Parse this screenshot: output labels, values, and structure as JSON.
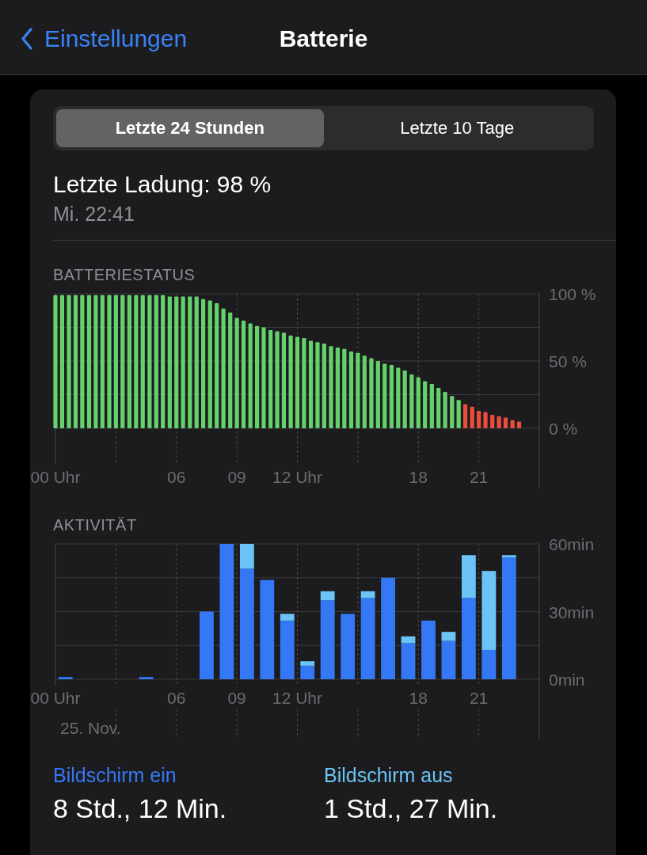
{
  "nav": {
    "back_label": "Einstellungen",
    "title": "Batterie"
  },
  "segments": [
    {
      "label": "Letzte 24 Stunden",
      "selected": true
    },
    {
      "label": "Letzte 10 Tage",
      "selected": false
    }
  ],
  "last_charge": {
    "title": "Letzte Ladung: 98 %",
    "time": "Mi. 22:41"
  },
  "battery": {
    "heading": "BATTERIESTATUS",
    "chart_data": {
      "type": "bar",
      "grid": true,
      "xlim": [
        0,
        24
      ],
      "ylim": [
        0,
        100
      ],
      "xticks": [
        {
          "value": 0,
          "label": "00 Uhr"
        },
        {
          "value": 6,
          "label": "06"
        },
        {
          "value": 9,
          "label": "09"
        },
        {
          "value": 12,
          "label": "12 Uhr"
        },
        {
          "value": 18,
          "label": "18"
        },
        {
          "value": 21,
          "label": "21"
        }
      ],
      "yticks": [
        {
          "value": 100,
          "label": "100 %"
        },
        {
          "value": 50,
          "label": "50 %"
        },
        {
          "value": 0,
          "label": "0 %"
        }
      ],
      "x": [
        0,
        0.33,
        0.67,
        1,
        1.33,
        1.67,
        2,
        2.33,
        2.67,
        3,
        3.33,
        3.67,
        4,
        4.33,
        4.67,
        5,
        5.33,
        5.67,
        6,
        6.33,
        6.67,
        7,
        7.33,
        7.67,
        8,
        8.33,
        8.67,
        9,
        9.33,
        9.67,
        10,
        10.33,
        10.67,
        11,
        11.33,
        11.67,
        12,
        12.33,
        12.67,
        13,
        13.33,
        13.67,
        14,
        14.33,
        14.67,
        15,
        15.33,
        15.67,
        16,
        16.33,
        16.67,
        17,
        17.33,
        17.67,
        18,
        18.33,
        18.67,
        19,
        19.33,
        19.67,
        20,
        20.33,
        20.67,
        21,
        21.33,
        21.67,
        22,
        22.33,
        22.67,
        23
      ],
      "series": [
        {
          "color": "#65d16c",
          "values": [
            99,
            99,
            99,
            99,
            99,
            99,
            99,
            99,
            99,
            99,
            99,
            99,
            99,
            99,
            99,
            99,
            99,
            98,
            98,
            98,
            98,
            98,
            96,
            95,
            93,
            89,
            86,
            82,
            80,
            78,
            76,
            75,
            73,
            72,
            71,
            69,
            68,
            67,
            65,
            64,
            63,
            61,
            60,
            59,
            57,
            56,
            54,
            52,
            50,
            48,
            47,
            45,
            43,
            40,
            38,
            35,
            33,
            30,
            27,
            24,
            21,
            null,
            null,
            null,
            null,
            null,
            null,
            null,
            null,
            null
          ]
        },
        {
          "color": "#eb4d3d",
          "values": [
            null,
            null,
            null,
            null,
            null,
            null,
            null,
            null,
            null,
            null,
            null,
            null,
            null,
            null,
            null,
            null,
            null,
            null,
            null,
            null,
            null,
            null,
            null,
            null,
            null,
            null,
            null,
            null,
            null,
            null,
            null,
            null,
            null,
            null,
            null,
            null,
            null,
            null,
            null,
            null,
            null,
            null,
            null,
            null,
            null,
            null,
            null,
            null,
            null,
            null,
            null,
            null,
            null,
            null,
            null,
            null,
            null,
            null,
            null,
            null,
            null,
            18,
            16,
            13,
            12,
            10,
            9,
            8,
            6,
            5
          ]
        }
      ]
    }
  },
  "activity": {
    "heading": "AKTIVITÄT",
    "date_label": "25. Nov.",
    "chart_data": {
      "type": "bar",
      "grid": true,
      "stacked": true,
      "xlim": [
        0,
        24
      ],
      "ylim": [
        0,
        60
      ],
      "xticks": [
        {
          "value": 0,
          "label": "00 Uhr"
        },
        {
          "value": 6,
          "label": "06"
        },
        {
          "value": 9,
          "label": "09"
        },
        {
          "value": 12,
          "label": "12 Uhr"
        },
        {
          "value": 18,
          "label": "18"
        },
        {
          "value": 21,
          "label": "21"
        }
      ],
      "yticks": [
        {
          "value": 60,
          "label": "60min"
        },
        {
          "value": 30,
          "label": "30min"
        },
        {
          "value": 0,
          "label": "0min"
        }
      ],
      "x": [
        0.5,
        1.5,
        2.5,
        3.5,
        4.5,
        5.5,
        6.5,
        7.5,
        8.5,
        9.5,
        10.5,
        11.5,
        12.5,
        13.5,
        14.5,
        15.5,
        16.5,
        17.5,
        18.5,
        19.5,
        20.5,
        21.5,
        22.5
      ],
      "series": [
        {
          "name": "Bildschirm ein",
          "color": "#3478f6",
          "values": [
            1,
            0,
            0,
            0,
            1,
            0,
            0,
            30,
            60,
            49,
            44,
            26,
            6,
            35,
            29,
            36,
            45,
            16,
            26,
            17,
            36,
            13,
            54
          ]
        },
        {
          "name": "Bildschirm aus",
          "color": "#6ac4f5",
          "values": [
            0,
            0,
            0,
            0,
            0,
            0,
            0,
            0,
            0,
            11,
            0,
            3,
            2,
            4,
            0,
            3,
            0,
            3,
            0,
            4,
            19,
            35,
            1
          ]
        }
      ]
    }
  },
  "summary": [
    {
      "value": "8 Std., 12 Min."
    },
    {
      "value": "1 Std., 27 Min."
    }
  ]
}
